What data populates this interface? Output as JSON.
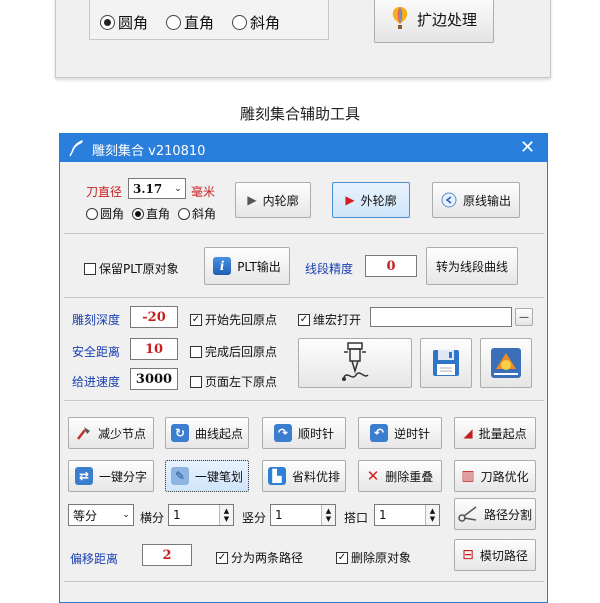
{
  "top_panel": {
    "corner_options": [
      {
        "label": "圆角",
        "selected": true
      },
      {
        "label": "直角",
        "selected": false
      },
      {
        "label": "斜角",
        "selected": false
      }
    ],
    "edge_button_label": "扩边处理"
  },
  "page_caption": "雕刻集合辅助工具",
  "window": {
    "title": "雕刻集合 v210810",
    "close_glyph": "✕"
  },
  "tool": {
    "diameter_label": "刀直径",
    "diameter_value": "3.17",
    "diameter_unit": "毫米",
    "corner_options": [
      {
        "label": "圆角",
        "selected": false
      },
      {
        "label": "直角",
        "selected": true
      },
      {
        "label": "斜角",
        "selected": false
      }
    ],
    "inner_contour_label": "内轮廓",
    "outer_contour_label": "外轮廓",
    "original_output_label": "原线输出"
  },
  "plt": {
    "keep_original_label": "保留PLT原对象",
    "output_label": "PLT输出",
    "precision_label": "线段精度",
    "precision_value": "0",
    "convert_label": "转为线段曲线"
  },
  "params": {
    "depth_label": "雕刻深度",
    "depth_value": "-20",
    "safe_distance_label": "安全距离",
    "safe_distance_value": "10",
    "feed_speed_label": "给进速度",
    "feed_speed_value": "3000",
    "start_home_label": "开始先回原点",
    "macro_open_label": "维宏打开",
    "end_home_label": "完成后回原点",
    "page_origin_label": "页面左下原点",
    "macro_path_value": "",
    "minus_glyph": "—"
  },
  "actions": {
    "reduce_nodes": "减少节点",
    "curve_start": "曲线起点",
    "clockwise": "顺时针",
    "counter_clockwise": "逆时针",
    "batch_start": "批量起点",
    "split_chars": "一键分字",
    "one_stroke": "一键笔划",
    "optimize_material": "省料优排",
    "remove_duplicates": "删除重叠",
    "toolpath_optimize": "刀路优化"
  },
  "division": {
    "mode_value": "等分",
    "horizontal_label": "横分",
    "horizontal_value": "1",
    "vertical_label": "竖分",
    "vertical_value": "1",
    "tab_label": "搭口",
    "tab_value": "1",
    "split_path_label": "路径分割"
  },
  "offset": {
    "offset_label": "偏移距离",
    "offset_value": "2",
    "two_paths_label": "分为两条路径",
    "delete_original_label": "删除原对象",
    "die_cut_label": "模切路径"
  },
  "colors": {
    "title_bar": "#2b7fdc",
    "label_blue": "#1a3fb0",
    "label_red": "#cc2222"
  }
}
